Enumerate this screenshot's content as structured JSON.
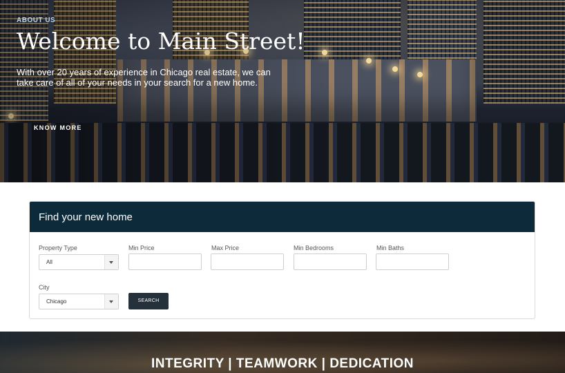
{
  "hero": {
    "eyebrow": "ABOUT US",
    "title": "Welcome to Main Street!",
    "description": "With over 20 years of experience in Chicago real estate, we can take care of all of your needs in your search for a new home.",
    "cta_label": "KNOW MORE"
  },
  "search": {
    "title": "Find your new home",
    "fields": {
      "property_type": {
        "label": "Property Type",
        "value": "All"
      },
      "min_price": {
        "label": "Min Price",
        "value": "",
        "placeholder": ""
      },
      "max_price": {
        "label": "Max Price",
        "value": "",
        "placeholder": ""
      },
      "min_bedrooms": {
        "label": "Min Bedrooms",
        "value": "",
        "placeholder": ""
      },
      "min_baths": {
        "label": "Min Baths",
        "value": "",
        "placeholder": ""
      },
      "city": {
        "label": "City",
        "value": "Chicago"
      }
    },
    "button_label": "SEARCH"
  },
  "banner": {
    "text": "INTEGRITY | TEAMWORK | DEDICATION"
  },
  "colors": {
    "card_header": "#0d2a3a",
    "search_button": "#24313b",
    "eyebrow": "#bcd8ee"
  }
}
